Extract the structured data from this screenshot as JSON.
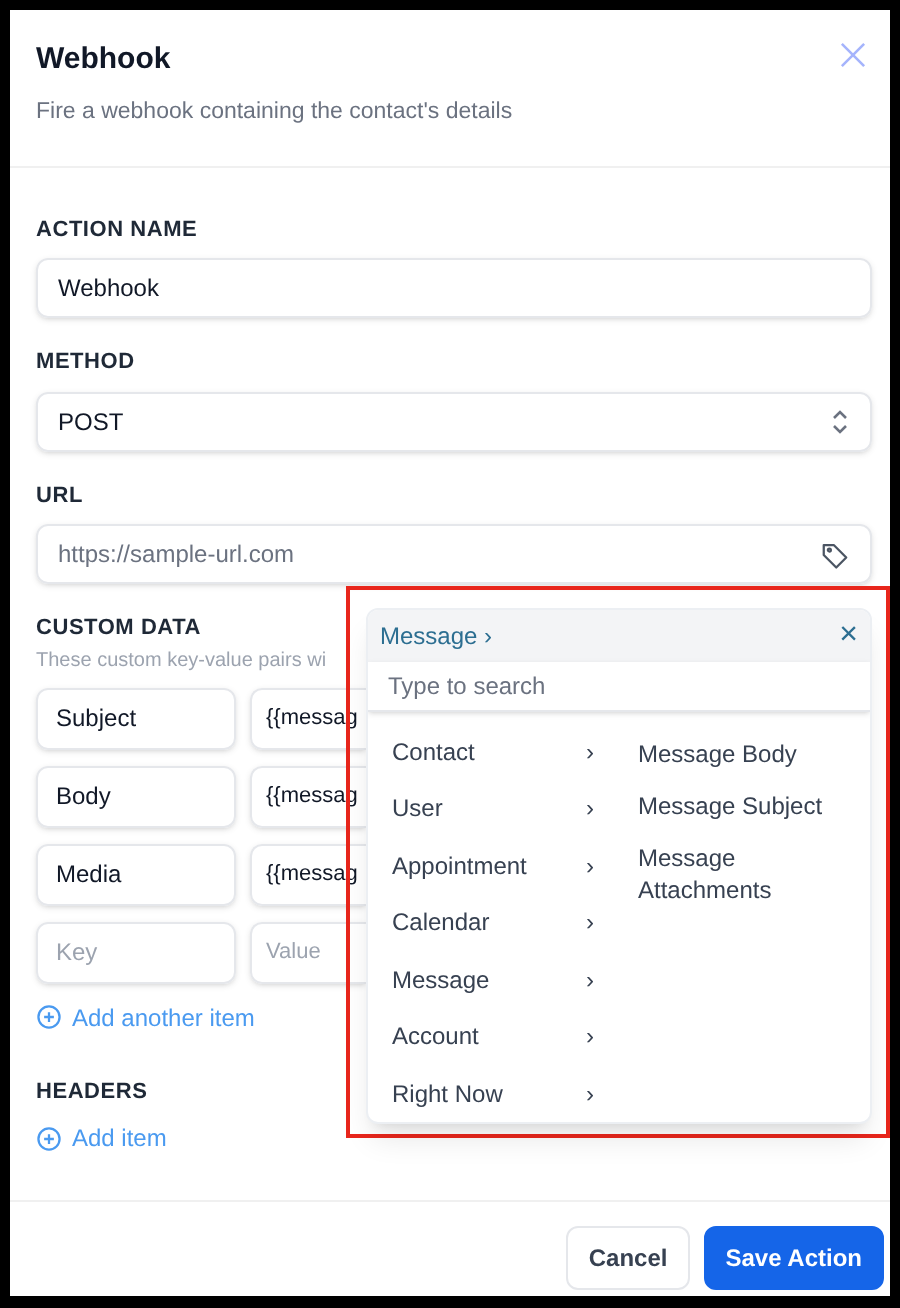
{
  "dialog": {
    "title": "Webhook",
    "subtitle": "Fire a webhook containing the contact's details"
  },
  "fields": [
    {
      "kind": "text",
      "label": "ACTION NAME",
      "value": "Webhook"
    },
    {
      "kind": "select",
      "label": "METHOD",
      "value": "POST"
    },
    {
      "kind": "url",
      "label": "URL",
      "placeholder": "https://sample-url.com"
    }
  ],
  "custom_data": {
    "label": "CUSTOM DATA",
    "hint": "These custom key-value pairs wi",
    "rows": [
      {
        "key": "Subject",
        "value": "{{messag"
      },
      {
        "key": "Body",
        "value": "{{messag"
      },
      {
        "key": "Media",
        "value": "{{messag"
      },
      {
        "key_placeholder": "Key",
        "value_placeholder": "Value"
      }
    ],
    "add_link": "Add another item"
  },
  "headers": {
    "label": "HEADERS",
    "add_link": "Add item"
  },
  "dropdown": {
    "highlighted": true,
    "breadcrumb": "Message ›",
    "close": "×",
    "search_placeholder": "Type to search",
    "categories": [
      {
        "label": "Contact",
        "arrow": "›"
      },
      {
        "label": "User",
        "arrow": "›"
      },
      {
        "label": "Appointment",
        "arrow": "›"
      },
      {
        "label": "Calendar",
        "arrow": "›"
      },
      {
        "label": "Message",
        "arrow": "›"
      },
      {
        "label": "Account",
        "arrow": "›"
      },
      {
        "label": "Right Now",
        "arrow": "›"
      }
    ],
    "options": [
      "Message Body",
      "Message Subject",
      "Message Attachments"
    ]
  },
  "buttons": [
    {
      "kind": "secondary",
      "label": "Cancel"
    },
    {
      "kind": "primary",
      "label": "Save Action"
    }
  ]
}
